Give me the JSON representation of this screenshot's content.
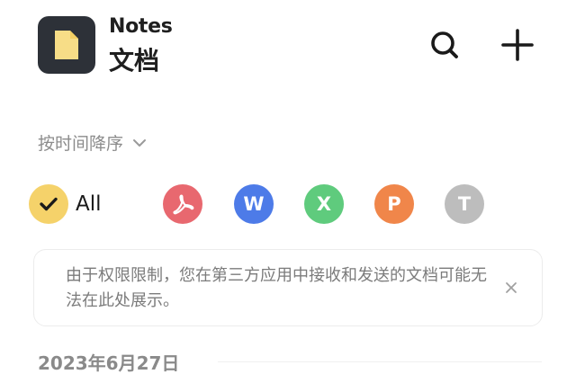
{
  "header": {
    "title_en": "Notes",
    "title_zh": "文档",
    "app_icon": "document-icon",
    "search_icon": "search-icon",
    "add_icon": "plus-icon"
  },
  "sort": {
    "label": "按时间降序",
    "icon": "chevron-down-icon"
  },
  "filters": [
    {
      "key": "all",
      "label": "All",
      "icon": "checkmark-icon",
      "color": "#f5d26a",
      "selected": true
    },
    {
      "key": "pdf",
      "label": "",
      "icon": "pdf-icon",
      "color": "#e8686f"
    },
    {
      "key": "word",
      "label": "W",
      "icon": "word-icon",
      "color": "#4d7be8"
    },
    {
      "key": "excel",
      "label": "X",
      "icon": "excel-icon",
      "color": "#5fcb7d"
    },
    {
      "key": "ppt",
      "label": "P",
      "icon": "powerpoint-icon",
      "color": "#f0864a"
    },
    {
      "key": "text",
      "label": "T",
      "icon": "text-icon",
      "color": "#bdbdbd"
    }
  ],
  "notice": {
    "text": "由于权限限制，您在第三方应用中接收和发送的文档可能无法在此处展示。",
    "close_icon": "close-icon"
  },
  "date_group": {
    "label": "2023年6月27日"
  },
  "colors": {
    "accent": "#f5d26a",
    "app_icon_bg": "#2d3138",
    "muted_text": "#8c8c8c"
  }
}
